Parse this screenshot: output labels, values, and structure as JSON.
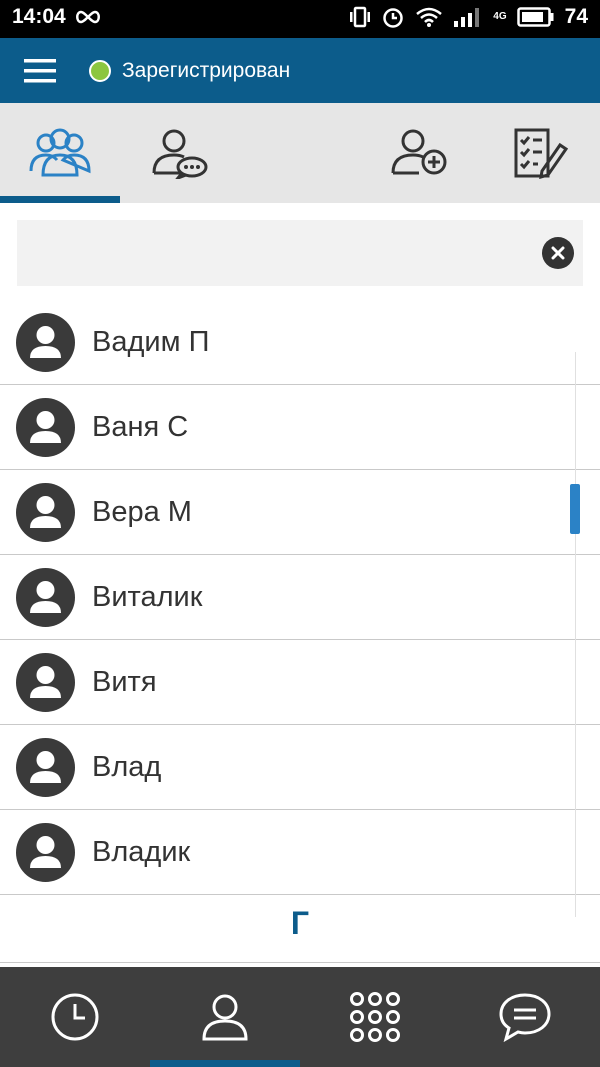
{
  "status_bar": {
    "time": "14:04",
    "battery": "74",
    "network": "4G"
  },
  "app_bar": {
    "registration_status": "Зарегистрирован",
    "status_color": "#8cc63f",
    "accent_color": "#0c5c8b"
  },
  "tabs": [
    {
      "name": "contacts",
      "icon": "contacts-group-icon",
      "active": true
    },
    {
      "name": "chat-contacts",
      "icon": "contact-chat-icon",
      "active": false
    },
    {
      "name": "add-contact",
      "icon": "add-contact-icon",
      "active": false
    },
    {
      "name": "edit-list",
      "icon": "checklist-edit-icon",
      "active": false
    }
  ],
  "search": {
    "value": "",
    "placeholder": ""
  },
  "contacts": [
    {
      "name": "Вадим П"
    },
    {
      "name": "Ваня С"
    },
    {
      "name": "Вера М"
    },
    {
      "name": "Виталик"
    },
    {
      "name": "Витя"
    },
    {
      "name": "Влад"
    },
    {
      "name": "Владик"
    }
  ],
  "section_letter": "Г",
  "bottom_nav": [
    {
      "name": "history",
      "icon": "clock-icon",
      "active": false
    },
    {
      "name": "contacts",
      "icon": "person-icon",
      "active": true
    },
    {
      "name": "dialpad",
      "icon": "dialpad-icon",
      "active": false
    },
    {
      "name": "messages",
      "icon": "chat-bubble-icon",
      "active": false
    }
  ]
}
